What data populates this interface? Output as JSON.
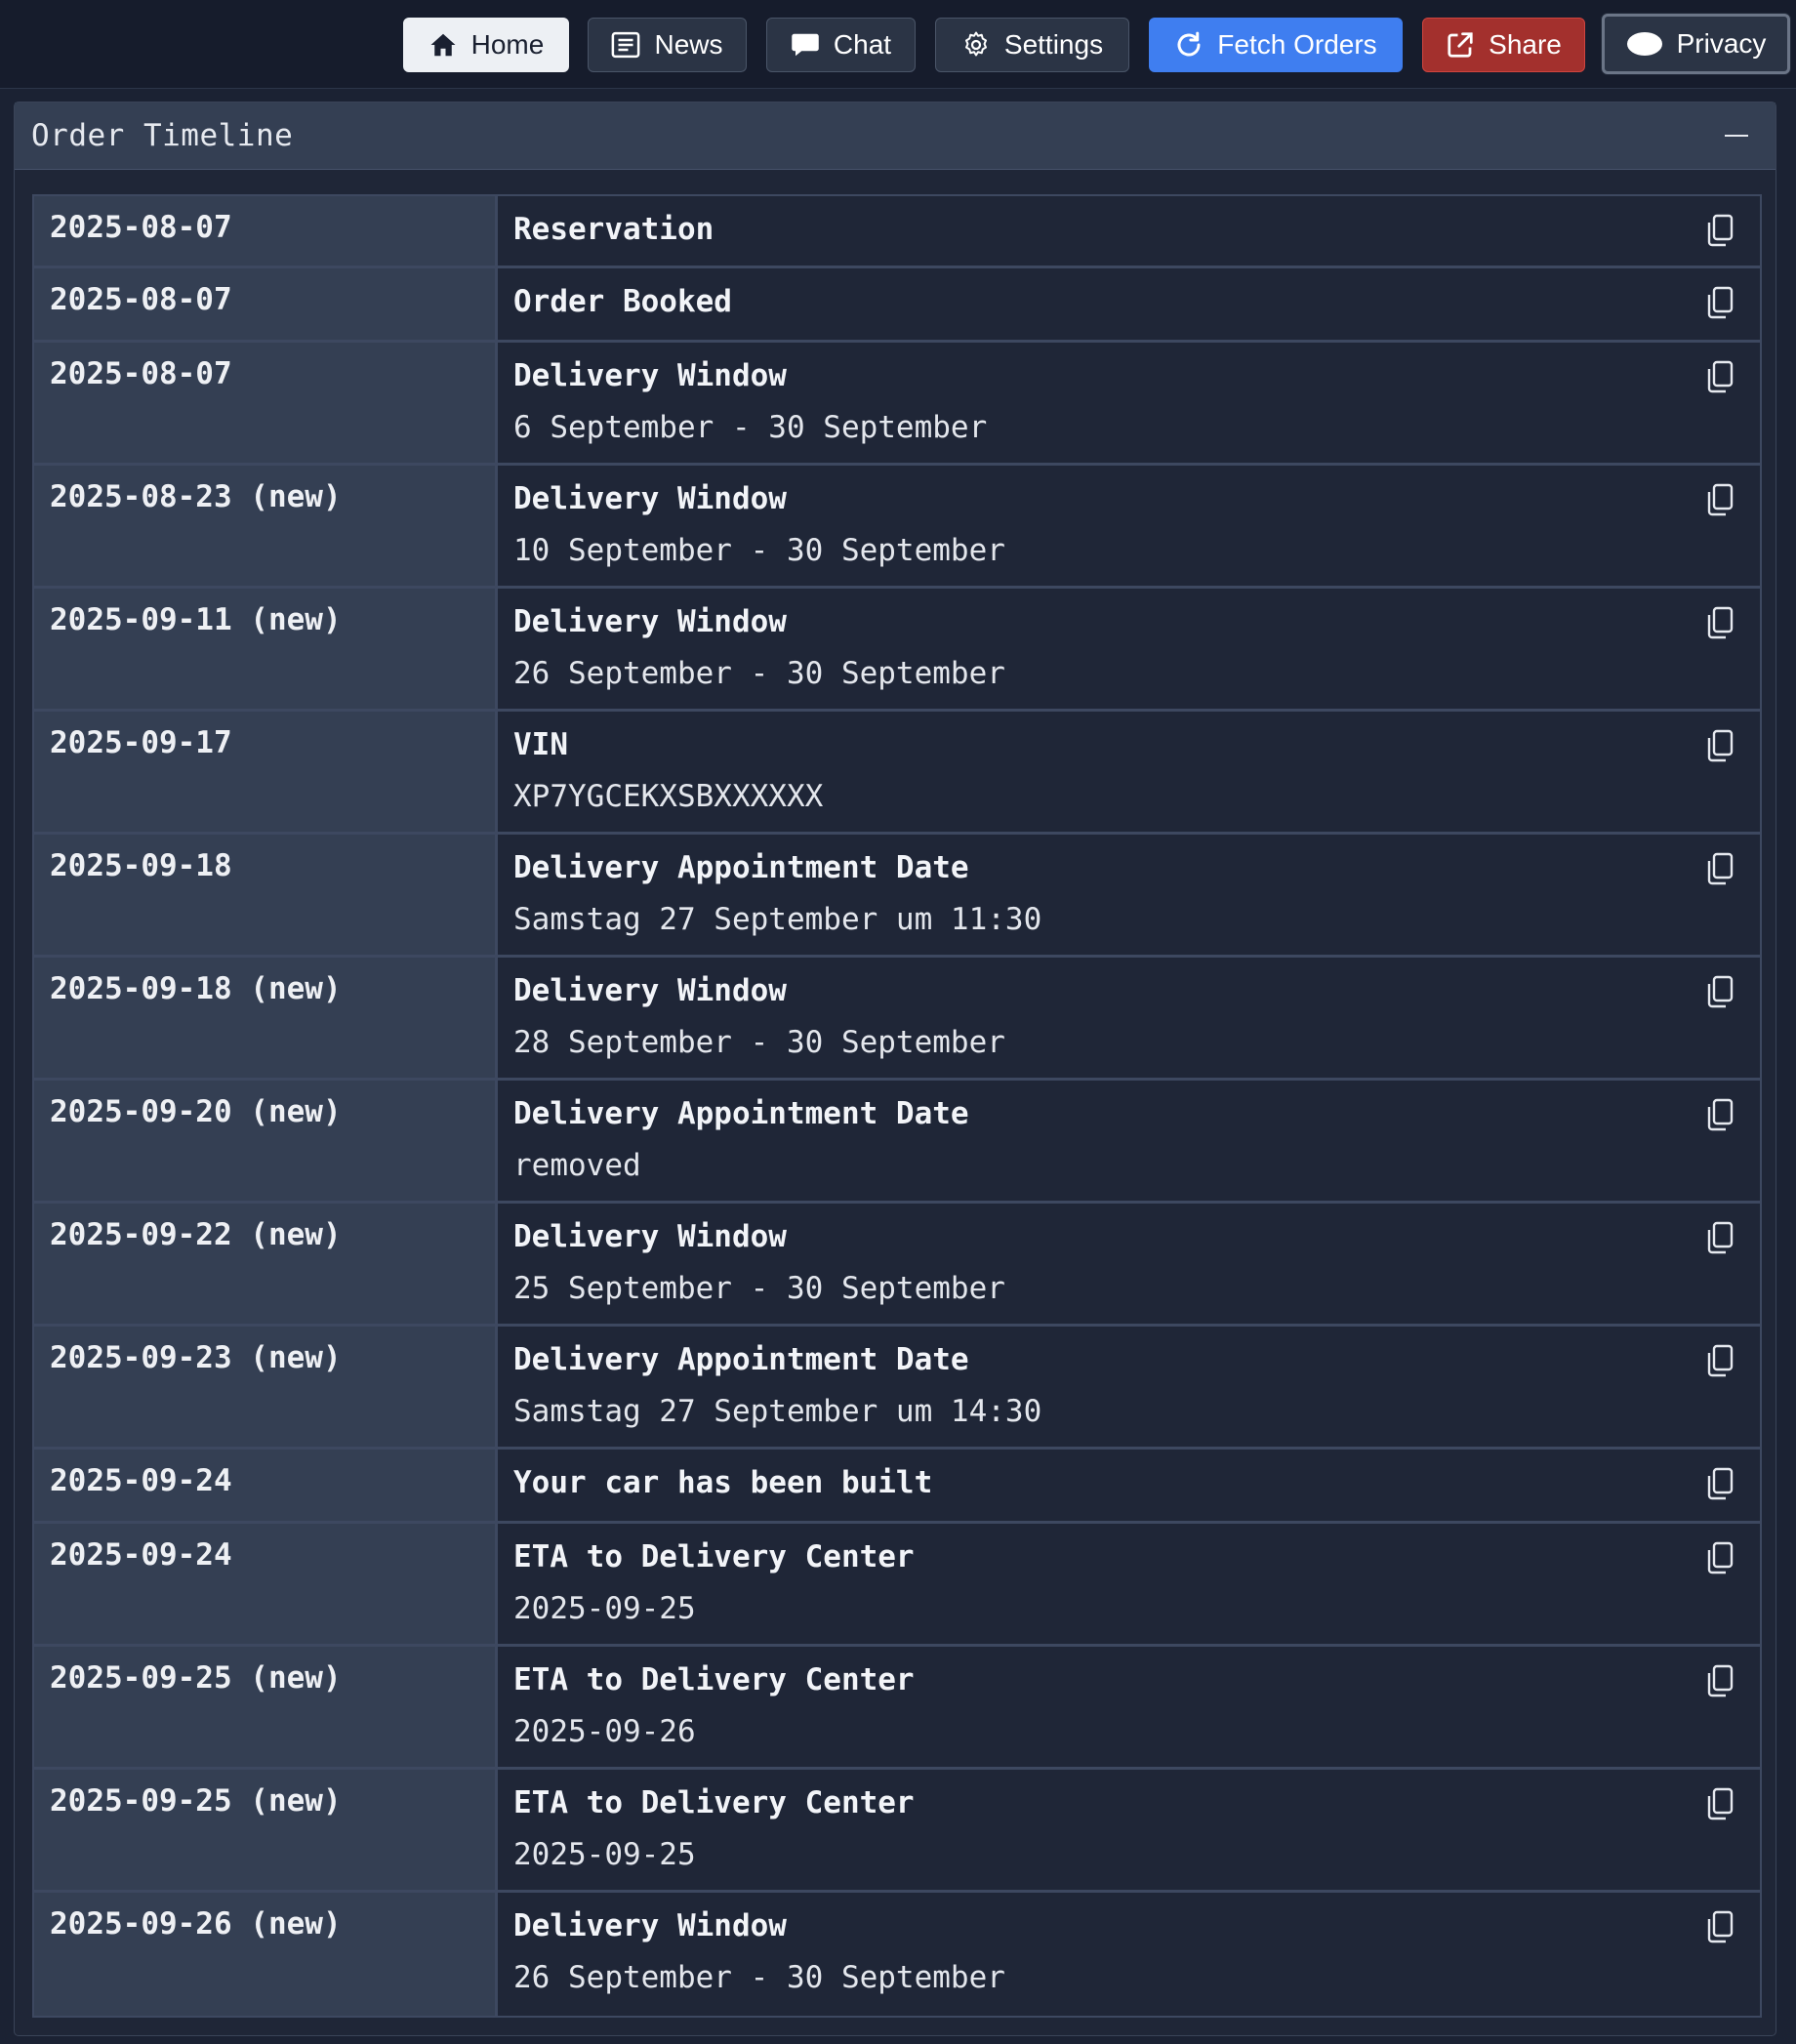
{
  "toolbar": {
    "home": "Home",
    "news": "News",
    "chat": "Chat",
    "settings": "Settings",
    "fetch_orders": "Fetch Orders",
    "share": "Share",
    "privacy": "Privacy"
  },
  "panel": {
    "title": "Order Timeline"
  },
  "timeline": [
    {
      "date": "2025-08-07",
      "title": "Reservation",
      "detail": ""
    },
    {
      "date": "2025-08-07",
      "title": "Order Booked",
      "detail": ""
    },
    {
      "date": "2025-08-07",
      "title": "Delivery Window",
      "detail": "6 September - 30 September"
    },
    {
      "date": "2025-08-23 (new)",
      "title": "Delivery Window",
      "detail": "10 September - 30 September"
    },
    {
      "date": "2025-09-11 (new)",
      "title": "Delivery Window",
      "detail": "26 September - 30 September"
    },
    {
      "date": "2025-09-17",
      "title": "VIN",
      "detail": "XP7YGCEKXSBXXXXXX"
    },
    {
      "date": "2025-09-18",
      "title": "Delivery Appointment Date",
      "detail": "Samstag 27 September um 11:30"
    },
    {
      "date": "2025-09-18 (new)",
      "title": "Delivery Window",
      "detail": "28 September - 30 September"
    },
    {
      "date": "2025-09-20 (new)",
      "title": "Delivery Appointment Date",
      "detail": "removed"
    },
    {
      "date": "2025-09-22 (new)",
      "title": "Delivery Window",
      "detail": "25 September - 30 September"
    },
    {
      "date": "2025-09-23 (new)",
      "title": "Delivery Appointment Date",
      "detail": "Samstag 27 September um 14:30"
    },
    {
      "date": "2025-09-24",
      "title": "Your car has been built",
      "detail": ""
    },
    {
      "date": "2025-09-24",
      "title": "ETA to Delivery Center",
      "detail": "2025-09-25"
    },
    {
      "date": "2025-09-25 (new)",
      "title": "ETA to Delivery Center",
      "detail": "2025-09-26"
    },
    {
      "date": "2025-09-25 (new)",
      "title": "ETA to Delivery Center",
      "detail": "2025-09-25"
    },
    {
      "date": "2025-09-26 (new)",
      "title": "Delivery Window",
      "detail": "26 September - 30 September"
    }
  ],
  "colors": {
    "background": "#1b2233",
    "header_bar": "#161c2c",
    "fetch_button": "#3f7ef0",
    "share_button": "#a3302d",
    "date_cell": "#343f53",
    "event_cell": "#1f2637"
  }
}
